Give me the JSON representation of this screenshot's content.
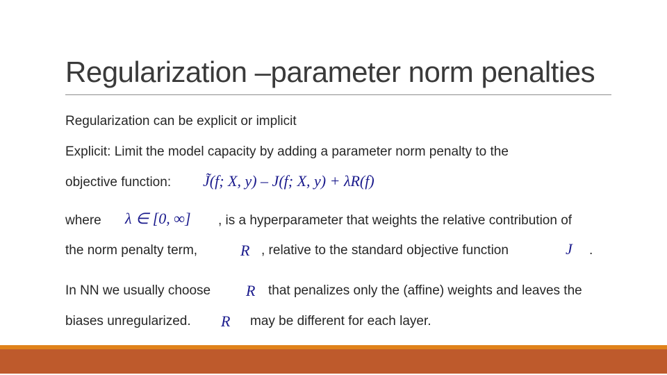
{
  "slide": {
    "title": "Regularization –parameter norm penalties",
    "lines": [
      "Regularization can be explicit or implicit",
      "Explicit: Limit the model capacity by adding a parameter norm penalty to the",
      "objective function:",
      "where",
      ", is a hyperparameter that weights the relative contribution of",
      "the   norm penalty term,",
      ", relative to the standard objective function",
      ".",
      "In NN  we usually choose",
      "that penalizes only the (affine) weights and leaves  the",
      "biases unregularized.",
      "may be different for each layer."
    ],
    "math": {
      "objective": "J̃(f; X, y) – J(f; X, y) + λR(f)",
      "lambda_range": "λ ∈ [0, ∞]",
      "R": "R",
      "J": "J"
    }
  },
  "colors": {
    "footer_accent": "#E0821A",
    "footer_band": "#BE5A2C",
    "math": "#1a1a8c"
  }
}
